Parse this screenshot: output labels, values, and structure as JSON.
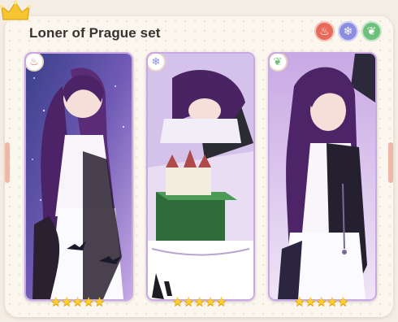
{
  "set": {
    "title": "Loner of Prague set"
  },
  "elements": [
    {
      "icon": "flame-icon",
      "color": "#e86b5a",
      "glyph": "♨"
    },
    {
      "icon": "ice-icon",
      "color": "#8b8de0",
      "glyph": "❄"
    },
    {
      "icon": "leaf-icon",
      "color": "#6cc07a",
      "glyph": "❦"
    }
  ],
  "cards": [
    {
      "element_icon": "flame-icon",
      "element_color": "#e86b5a",
      "badge_glyph": "♨",
      "stars": "★★★★★",
      "rarity": 5
    },
    {
      "element_icon": "ice-icon",
      "element_color": "#8b8de0",
      "badge_glyph": "❄",
      "stars": "★★★★★",
      "rarity": 5
    },
    {
      "element_icon": "leaf-icon",
      "element_color": "#6cc07a",
      "badge_glyph": "❦",
      "stars": "★★★★★",
      "rarity": 5
    }
  ]
}
